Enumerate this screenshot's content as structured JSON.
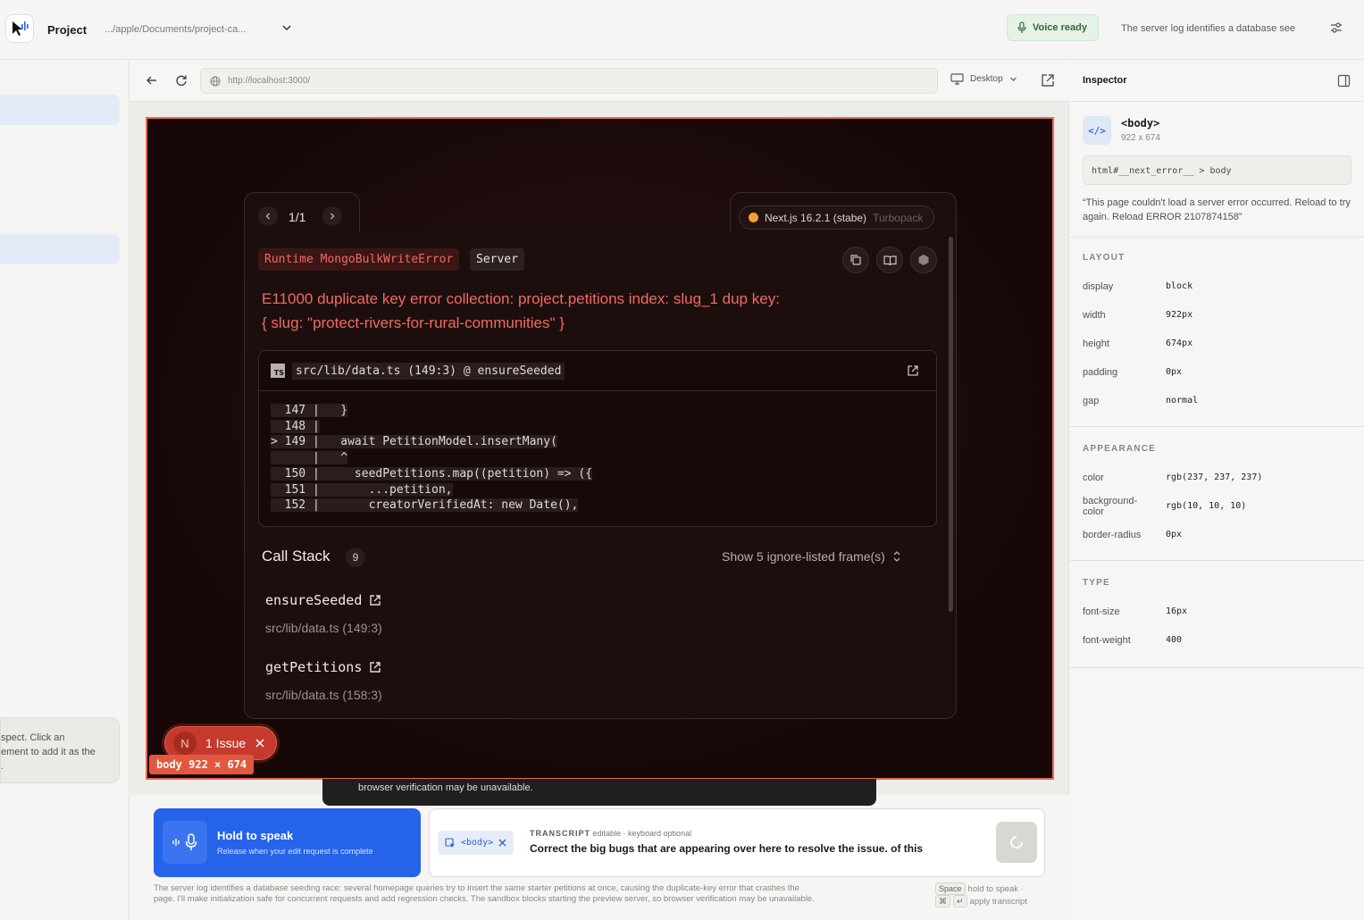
{
  "header": {
    "project_title": "Project",
    "project_path": ".../apple/Documents/project-ca...",
    "voice_status": "Voice ready",
    "summary_truncated": "The server log identifies a database see"
  },
  "sidebar": {
    "note_lines": [
      "spect. Click an",
      "ement to add it as the",
      "."
    ]
  },
  "browser": {
    "url": "http://localhost:3000/",
    "device": "Desktop"
  },
  "error_overlay": {
    "pager": "1/1",
    "nextjs_version": "Next.js 16.2.1 (stabe)",
    "bundler": "Turbopack",
    "error_type": "Runtime MongoBulkWriteError",
    "error_env": "Server",
    "message_line1": "E11000 duplicate key error collection: project.petitions index: slug_1 dup key:",
    "message_line2": "{ slug: \"protect-rivers-for-rural-communities\" }",
    "code_file": "src/lib/data.ts (149:3) @ ensureSeeded",
    "code_lines": [
      "  147 |   }",
      "  148 |",
      "> 149 |   await PetitionModel.insertMany(",
      "      |   ^",
      "  150 |     seedPetitions.map((petition) => ({",
      "  151 |       ...petition,",
      "  152 |       creatorVerifiedAt: new Date(),"
    ],
    "call_stack_title": "Call Stack",
    "call_stack_count": "9",
    "ignore_toggle": "Show 5 ignore-listed frame(s)",
    "frames": [
      {
        "fn": "ensureSeeded",
        "loc": "src/lib/data.ts (149:3)"
      },
      {
        "fn": "getPetitions",
        "loc": "src/lib/data.ts (158:3)"
      }
    ],
    "issue_badge_letter": "N",
    "issue_label": "1 Issue"
  },
  "selection_tag": "body  922 × 674",
  "toast_text": "browser verification may be unavailable.",
  "inspector": {
    "title": "Inspector",
    "element_icon": "</>",
    "element_name": "<body>",
    "element_size": "922 x 674",
    "selector": "html#__next_error__ > body",
    "element_text": "“This page couldn't load a server error occurred. Reload to try again. Reload ERROR 2107874158”",
    "sections": {
      "layout": {
        "title": "LAYOUT",
        "props": [
          {
            "key": "display",
            "value": "block"
          },
          {
            "key": "width",
            "value": "922px"
          },
          {
            "key": "height",
            "value": "674px"
          },
          {
            "key": "padding",
            "value": "0px"
          },
          {
            "key": "gap",
            "value": "normal"
          }
        ]
      },
      "appearance": {
        "title": "APPEARANCE",
        "props": [
          {
            "key": "color",
            "value": "rgb(237, 237, 237)"
          },
          {
            "key": "background-color",
            "key_line1": "background-",
            "key_line2": "color",
            "value": "rgb(10, 10, 10)"
          },
          {
            "key": "border-radius",
            "value": "0px"
          }
        ]
      },
      "type": {
        "title": "TYPE",
        "props": [
          {
            "key": "font-size",
            "value": "16px"
          },
          {
            "key": "font-weight",
            "value": "400"
          }
        ]
      }
    }
  },
  "voice": {
    "hold_title": "Hold to speak",
    "hold_sub": "Release when your edit request is complete",
    "chip_label": "<body>",
    "transcript_label": "TRANSCRIPT",
    "transcript_meta": " editable · keyboard optional",
    "transcript_text": "Correct the big bugs that are appearing over here to resolve the issue. of this",
    "footer_line1": "The server log identifies a database seeding race: several homepage queries try to insert the same starter petitions at once, causing the duplicate-key error that crashes the",
    "footer_line2": "page. I'll make initialization safe for concurrent requests and add regression checks. The sandbox blocks starting the preview server, so browser verification may be unavailable.",
    "hint_space": "Space",
    "hint_hold": "hold to speak ·",
    "hint_cmd": "⌘",
    "hint_enter": "↵",
    "hint_apply": "apply transcript"
  },
  "colors": {
    "accent": "#2563eb",
    "error": "#f06a60",
    "selection": "#e96b57",
    "voice_ready": "#2f6a35"
  }
}
